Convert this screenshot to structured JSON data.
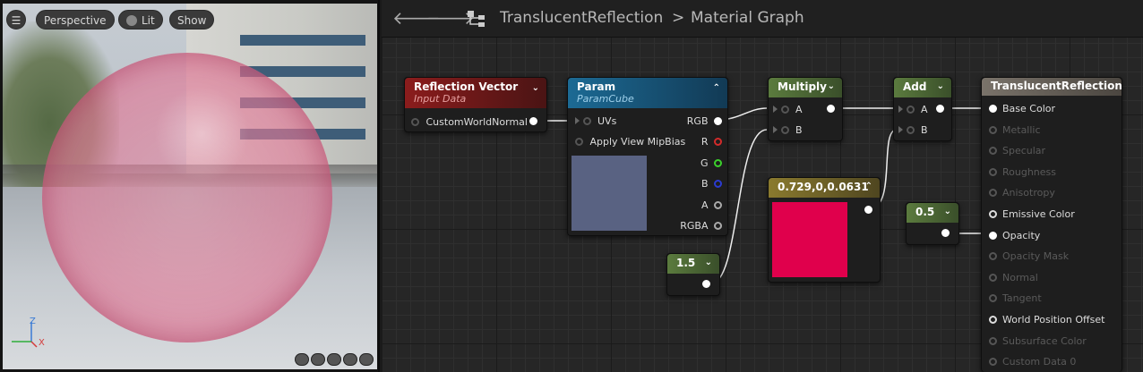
{
  "viewport": {
    "buttons": {
      "menu": "☰",
      "perspective": "Perspective",
      "lit": "Lit",
      "show": "Show"
    },
    "axes": {
      "z": "Z",
      "x": "X"
    }
  },
  "graph": {
    "breadcrumb": {
      "asset": "TranslucentReflection",
      "separator": ">",
      "page": "Material Graph"
    },
    "nodes": {
      "reflection": {
        "title": "Reflection Vector",
        "subtitle": "Input Data",
        "output": "CustomWorldNormal"
      },
      "param": {
        "title": "Param",
        "subtitle": "ParamCube",
        "inputs": [
          "UVs",
          "Apply View MipBias"
        ],
        "outputs": [
          "RGB",
          "R",
          "G",
          "B",
          "A",
          "RGBA"
        ],
        "preview_color": "#596282"
      },
      "const15": {
        "value": "1.5"
      },
      "multiply": {
        "title": "Multiply",
        "inputs": [
          "A",
          "B"
        ]
      },
      "color": {
        "title": "0.729,0,0.0631",
        "swatch": "#e0004c"
      },
      "add": {
        "title": "Add",
        "inputs": [
          "A",
          "B"
        ]
      },
      "const05": {
        "value": "0.5"
      },
      "result": {
        "title": "TranslucentReflection",
        "inputs": [
          {
            "label": "Base Color",
            "active": true
          },
          {
            "label": "Metallic",
            "active": false
          },
          {
            "label": "Specular",
            "active": false
          },
          {
            "label": "Roughness",
            "active": false
          },
          {
            "label": "Anisotropy",
            "active": false
          },
          {
            "label": "Emissive Color",
            "active": true
          },
          {
            "label": "Opacity",
            "active": true
          },
          {
            "label": "Opacity Mask",
            "active": false
          },
          {
            "label": "Normal",
            "active": false
          },
          {
            "label": "Tangent",
            "active": false
          },
          {
            "label": "World Position Offset",
            "active": true
          },
          {
            "label": "Subsurface Color",
            "active": false
          },
          {
            "label": "Custom Data 0",
            "active": false
          }
        ]
      }
    },
    "colors": {
      "reflection_header": "#7a1a1a",
      "param_header": "#1b5a7d",
      "math_header": "#4f6b3c",
      "color_header": "#7a6a2a",
      "result_header": "#6b645c"
    }
  }
}
